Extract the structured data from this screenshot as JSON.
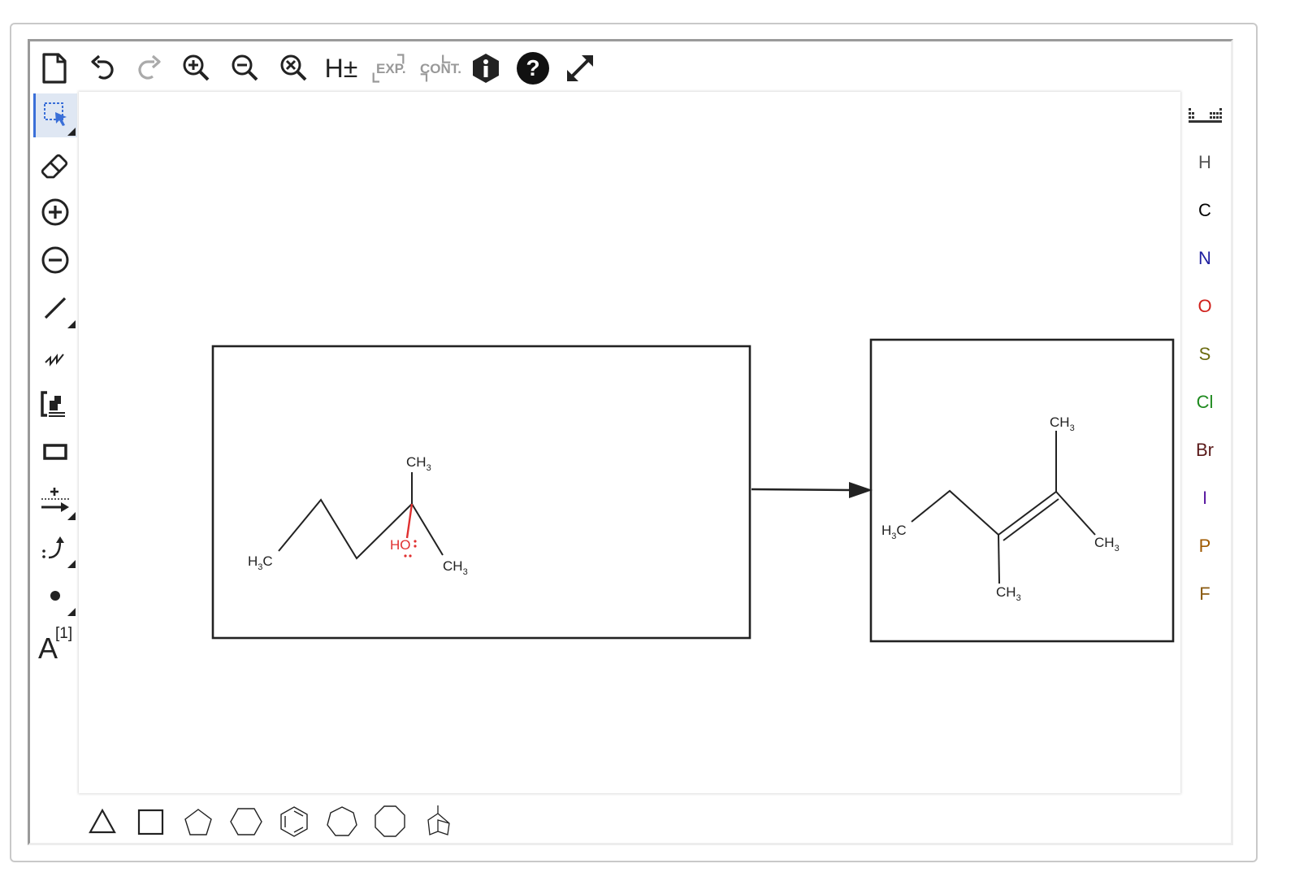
{
  "toolbar": {
    "items": [
      {
        "name": "new-document-button",
        "icon": "new-file-icon"
      },
      {
        "name": "undo-button",
        "icon": "undo-icon"
      },
      {
        "name": "redo-button",
        "icon": "redo-icon"
      },
      {
        "name": "zoom-in-button",
        "icon": "zoom-in-icon"
      },
      {
        "name": "zoom-out-button",
        "icon": "zoom-out-icon"
      },
      {
        "name": "zoom-reset-button",
        "icon": "zoom-reset-icon"
      },
      {
        "name": "toggle-hydrogens-button",
        "label": "H±"
      },
      {
        "name": "expand-button",
        "label": "EXP."
      },
      {
        "name": "contract-button",
        "label": "CONT."
      },
      {
        "name": "info-button",
        "icon": "info-icon"
      },
      {
        "name": "help-button",
        "icon": "help-icon"
      },
      {
        "name": "fullscreen-button",
        "icon": "fullscreen-icon"
      }
    ]
  },
  "left_tools": [
    {
      "name": "select-tool",
      "icon": "selection-icon",
      "active": true
    },
    {
      "name": "eraser-tool",
      "icon": "eraser-icon"
    },
    {
      "name": "positive-charge-tool",
      "icon": "plus-circle-icon"
    },
    {
      "name": "negative-charge-tool",
      "icon": "minus-circle-icon"
    },
    {
      "name": "bond-tool",
      "icon": "single-bond-icon"
    },
    {
      "name": "chain-tool",
      "icon": "chain-icon"
    },
    {
      "name": "sgroup-tool",
      "icon": "bracket-icon"
    },
    {
      "name": "rectangle-tool",
      "icon": "rectangle-icon"
    },
    {
      "name": "reaction-arrow-tool",
      "icon": "reaction-arrow-icon"
    },
    {
      "name": "electron-arrow-tool",
      "icon": "curved-arrow-icon"
    },
    {
      "name": "radical-tool",
      "icon": "dot-icon"
    },
    {
      "name": "atom-label-tool",
      "label": "A",
      "superscript": "[1]"
    }
  ],
  "atoms": {
    "periodic_table": {
      "name": "periodic-table-button",
      "icon": "periodic-table-icon"
    },
    "items": [
      {
        "symbol": "H",
        "color": "#555555"
      },
      {
        "symbol": "C",
        "color": "#000000"
      },
      {
        "symbol": "N",
        "color": "#1f1fa0"
      },
      {
        "symbol": "O",
        "color": "#d0201b"
      },
      {
        "symbol": "S",
        "color": "#6b6b10"
      },
      {
        "symbol": "Cl",
        "color": "#1e8a1e"
      },
      {
        "symbol": "Br",
        "color": "#5a1a1a"
      },
      {
        "symbol": "I",
        "color": "#5a1aa0"
      },
      {
        "symbol": "P",
        "color": "#a05a00"
      },
      {
        "symbol": "F",
        "color": "#8a5a10"
      }
    ]
  },
  "templates": [
    {
      "name": "cyclopropane-template",
      "icon": "triangle-icon"
    },
    {
      "name": "cyclobutane-template",
      "icon": "square-icon"
    },
    {
      "name": "cyclopentane-template",
      "icon": "pentagon-icon"
    },
    {
      "name": "cyclohexane-template",
      "icon": "hexagon-icon"
    },
    {
      "name": "benzene-template",
      "icon": "benzene-icon"
    },
    {
      "name": "cycloheptane-template",
      "icon": "heptagon-icon"
    },
    {
      "name": "cyclooctane-template",
      "icon": "octagon-icon"
    },
    {
      "name": "bicyclic-template",
      "icon": "bicyclo-icon"
    }
  ],
  "canvas": {
    "reactant": {
      "labels": {
        "ch3_top": "CH",
        "ch3_top_sub": "3",
        "h3c": "H",
        "h3c_sub": "3",
        "h3c_c": "C",
        "ch3_right": "CH",
        "ch3_right_sub": "3",
        "ho": "HO"
      },
      "oh_color": "#e03030"
    },
    "product": {
      "labels": {
        "ch3_top": "CH",
        "ch3_top_sub": "3",
        "h3c": "H",
        "h3c_sub": "3",
        "h3c_c": "C",
        "ch3_right": "CH",
        "ch3_right_sub": "3",
        "ch3_bottom": "CH",
        "ch3_bottom_sub": "3"
      }
    }
  }
}
